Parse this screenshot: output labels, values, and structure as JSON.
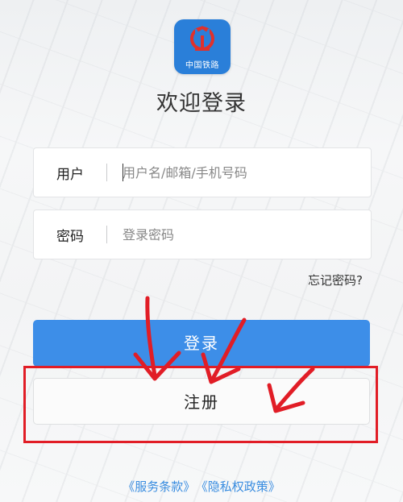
{
  "app": {
    "logo_text": "中国铁路",
    "welcome_title": "欢迎登录"
  },
  "form": {
    "username_label": "用户",
    "username_placeholder": "用户名/邮箱/手机号码",
    "password_label": "密码",
    "password_placeholder": "登录密码",
    "forgot_password": "忘记密码?"
  },
  "buttons": {
    "login": "登录",
    "register": "注册"
  },
  "footer": {
    "terms_of_service": "《服务条款》",
    "privacy_policy": "《隐私权政策》"
  },
  "colors": {
    "primary": "#3d8ee8",
    "logo_bg": "#2a7fd9",
    "annotation": "#e11d26",
    "link": "#3a8de0"
  },
  "icons": {
    "logo": "railway-logo-icon"
  }
}
